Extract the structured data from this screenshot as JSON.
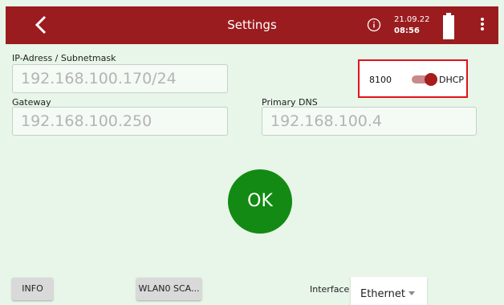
{
  "header": {
    "title": "Settings",
    "date": "21.09.22",
    "time": "08:56",
    "back_icon": "chevron-left-icon",
    "info_icon": "info-icon",
    "battery_icon": "battery-full-icon",
    "menu_icon": "kebab-menu-icon",
    "bar_color": "#9b1c1f"
  },
  "network": {
    "ip_label": "IP-Adress / Subnetmask",
    "ip_value": "192.168.100.170/24",
    "gateway_label": "Gateway",
    "gateway_value": "192.168.100.250",
    "dns_label": "Primary DNS",
    "dns_value": "192.168.100.4"
  },
  "dhcp": {
    "port": "8100",
    "label": "DHCP",
    "enabled": true,
    "highlight_color": "#e0121a"
  },
  "actions": {
    "ok_label": "OK",
    "ok_color": "#138a13",
    "info_label": "INFO",
    "wlan_label": "WLAN0 SCA..."
  },
  "interface": {
    "label": "Interface",
    "selected": "Ethernet"
  }
}
